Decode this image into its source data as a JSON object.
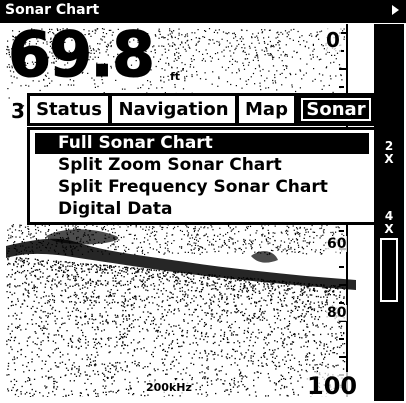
{
  "window": {
    "title": "Sonar Chart"
  },
  "readout": {
    "depth": "69.8",
    "depth_unit": "ft",
    "partial_digit": "3"
  },
  "scale": {
    "top": "0",
    "mid1": "60",
    "mid2": "80",
    "bottom": "100"
  },
  "frequency": "200kHz",
  "zoom": {
    "level_a": "2\nX",
    "level_b": "4\nX"
  },
  "menu": {
    "tabs": [
      {
        "label": "Status"
      },
      {
        "label": "Navigation"
      },
      {
        "label": "Map"
      },
      {
        "label": "Sonar"
      }
    ],
    "selected_tab": "Sonar",
    "items": [
      {
        "label": "Full Sonar Chart"
      },
      {
        "label": "Split Zoom Sonar Chart"
      },
      {
        "label": "Split Frequency Sonar Chart"
      },
      {
        "label": "Digital Data"
      }
    ],
    "selected_item": "Full Sonar Chart"
  },
  "colors": {
    "foreground": "#000000",
    "background": "#ffffff"
  }
}
